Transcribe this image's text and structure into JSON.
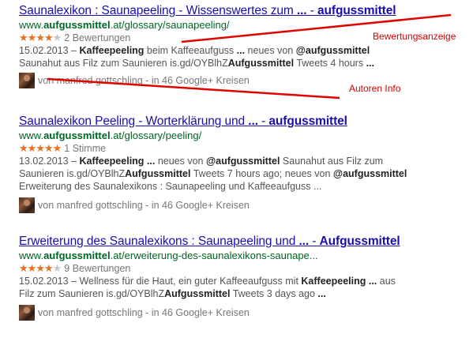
{
  "results": [
    {
      "title_parts": [
        "Saunalexikon : Saunapeeling - Wissenswertes zum ",
        "...",
        " - ",
        "aufgussmittel"
      ],
      "url_parts": [
        "www.",
        "aufgussmittel",
        ".at/glossary/saunapeeling/"
      ],
      "rating": 4,
      "rating_max": 5,
      "rating_text": "2 Bewertungen",
      "snippet_line1": [
        "15.02.2013 – ",
        "Kaffeepeeling",
        " beim Kaffeeaufguss ",
        "...",
        " neues von ",
        "@aufgussmittel"
      ],
      "snippet_line2": [
        "Saunahut aus Filz zum Saunieren is.gd/OYBlhZ",
        "Aufgussmittel",
        " Tweets 4 hours ",
        "..."
      ],
      "author": "von manfred gottschling - in 46 Google+ Kreisen"
    },
    {
      "title_parts": [
        "Saunalexikon Peeling - Worterklärung und ",
        "...",
        " - ",
        "aufgussmittel"
      ],
      "url_parts": [
        "www.",
        "aufgussmittel",
        ".at/glossary/peeling/"
      ],
      "rating": 5,
      "rating_max": 5,
      "rating_text": "1 Stimme",
      "snippet_line1": [
        "13.02.2013 – ",
        "Kaffeepeeling",
        " ",
        "...",
        " neues von ",
        "@aufgussmittel",
        " Saunahut aus Filz zum"
      ],
      "snippet_line2": [
        "Saunieren is.gd/OYBlhZ",
        "Aufgussmittel",
        " Tweets 7 hours ago; neues von ",
        "@aufgussmittel"
      ],
      "snippet_line3": "Erweiterung des Saunalexikons : Saunapeeling und Kaffeeaufguss ...",
      "author": "von manfred gottschling - in 46 Google+ Kreisen"
    },
    {
      "title_parts": [
        "Erweiterung des Saunalexikons : Saunapeeling und ",
        "...",
        " - ",
        "Aufgussmittel"
      ],
      "url_parts": [
        "www.",
        "aufgussmittel",
        ".at/erweiterung-des-saunalexikons-saunape..."
      ],
      "rating": 4,
      "rating_max": 5,
      "rating_text": "9 Bewertungen",
      "snippet_line1": [
        "15.02.2013 – Wellness für die Haut, ein guter Kaffeeaufguss mit ",
        "Kaffeepeeling",
        " ",
        "...",
        " aus"
      ],
      "snippet_line2": [
        "Filz zum Saunieren is.gd/OYBlhZ",
        "Aufgussmittel",
        " Tweets 3 days ago ",
        "..."
      ],
      "author": "von manfred gottschling - in 46 Google+ Kreisen"
    }
  ],
  "annotations": {
    "rating_label": "Bewertungsanzeige",
    "author_label": "Autoren Info"
  },
  "colors": {
    "title": "#1a0dab",
    "url": "#006621",
    "star": "#e7711b",
    "annotation": "#d40000"
  }
}
